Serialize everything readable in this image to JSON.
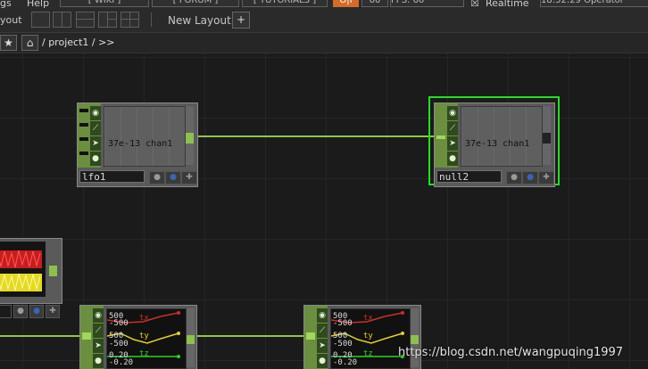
{
  "menubar": {
    "item_gs": "gs",
    "item_help": "Help",
    "wiki": "[ WIKI ]",
    "forum": "[ FORUM ]",
    "tutorials": "[ TUTORIALS ]",
    "oi": "O|I",
    "fps_left": "60",
    "fps": "FPS: 60",
    "realtime": "Realtime",
    "clock": "18:52:29 Operator"
  },
  "layoutbar": {
    "layout_label": "yout",
    "new_layout": "New Layout",
    "add": "+"
  },
  "pathbar": {
    "path": "/ project1 / >>"
  },
  "nodes": {
    "lfo1": {
      "name": "lfo1",
      "value": "37e-13",
      "channel": "chan1"
    },
    "null2": {
      "name": "null2",
      "value": "37e-13",
      "channel": "chan1"
    }
  },
  "chop_a": {
    "n1": "500",
    "n2": "-500",
    "n3": "500",
    "n4": "-500",
    "n5": "0.20",
    "n6": "-0.20",
    "tx": "tx",
    "ty": "ty",
    "tz": "tz"
  },
  "chop_b": {
    "n1": "500",
    "n2": "-500",
    "n3": "500",
    "n4": "-500",
    "n5": "0.20",
    "n6": "-0.20",
    "tx": "tx",
    "ty": "ty",
    "tz": "tz"
  },
  "watermark": "https://blog.csdn.net/wangpuqing1997",
  "colors": {
    "selected_outline": "#22e022",
    "connection": "#8ec74a",
    "tx_color": "#d12c2c",
    "ty_color": "#e0d21e",
    "tz_color": "#2fcf2f"
  }
}
